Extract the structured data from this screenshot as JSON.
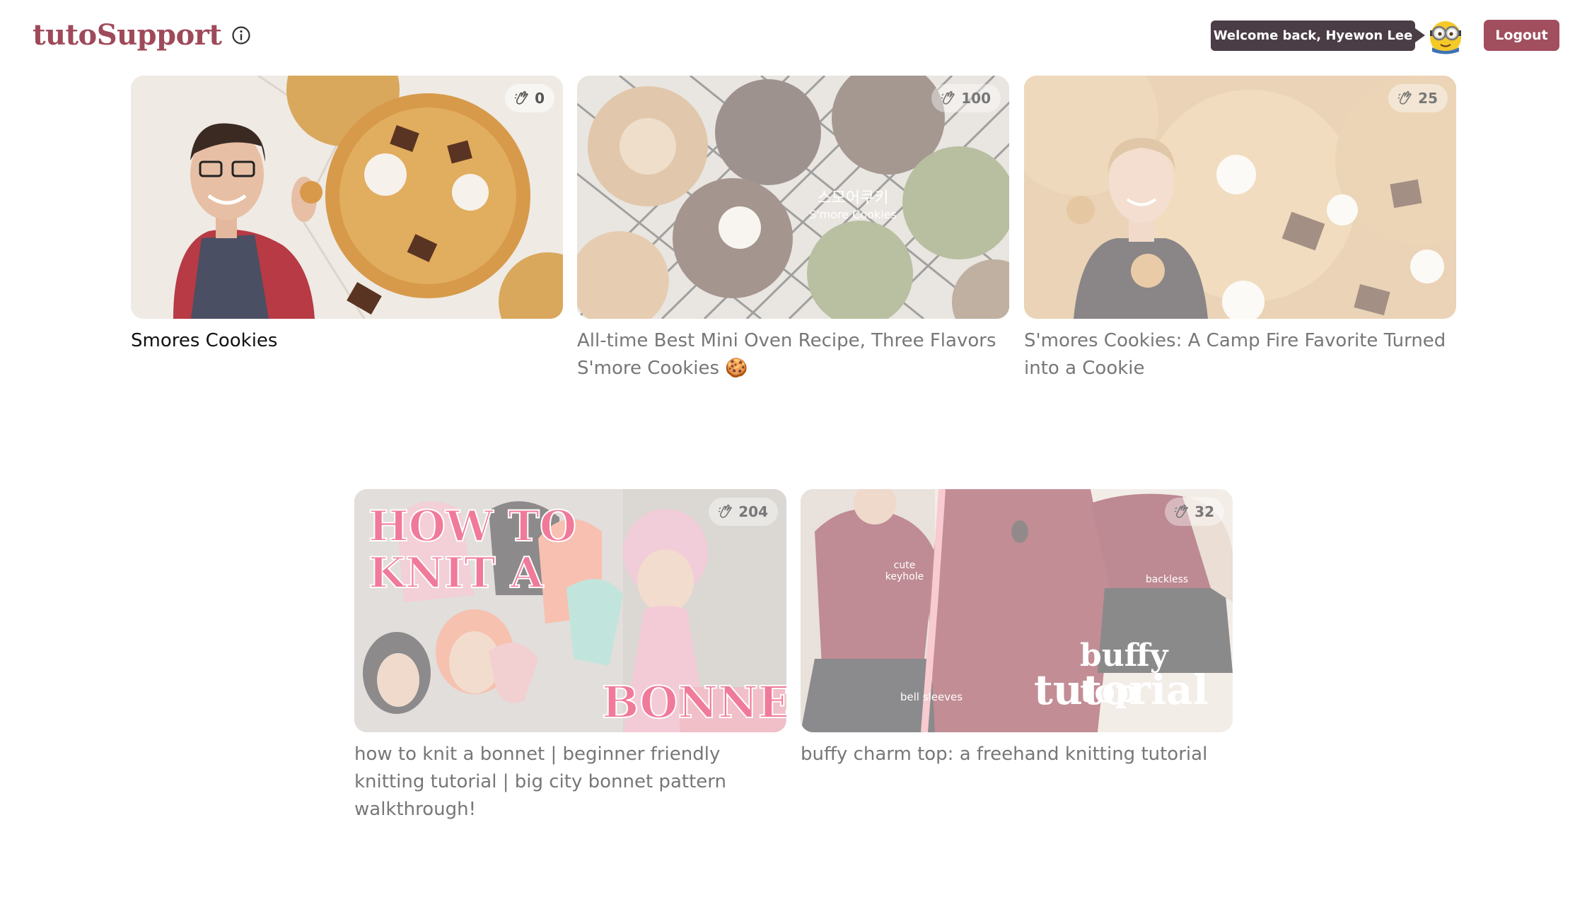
{
  "header": {
    "logo": "tutoSupport",
    "info_icon": "info-circle-icon",
    "welcome": "Welcome back, Hyewon Lee",
    "avatar_icon": "minion-avatar-icon",
    "logout_label": "Logout"
  },
  "colors": {
    "brand": "#9e4a5a",
    "logout_bg": "#a14e5e",
    "welcome_bg": "#4a3d45"
  },
  "badge_icon": "clapping-hands-icon",
  "videos": [
    {
      "title": "Smores Cookies",
      "claps": "0",
      "active": true,
      "thumb_icon": "cookie-thumbnail"
    },
    {
      "title": "All-time Best Mini Oven Recipe, Three Flavors S'more Cookies 🍪",
      "claps": "100",
      "active": false,
      "thumb_icon": "cookie-rack-thumbnail",
      "thumb_text_ko": "스모어쿠키",
      "thumb_text_en": "S'more Cookies"
    },
    {
      "title": "S'mores Cookies: A Camp Fire Favorite Turned into a Cookie",
      "claps": "25",
      "active": false,
      "thumb_icon": "cookie-woman-thumbnail"
    },
    {
      "title": "how to knit a bonnet | beginner friendly knitting tutorial | big city bonnet pattern walkthrough!",
      "claps": "204",
      "active": false,
      "thumb_icon": "bonnet-thumbnail",
      "thumb_text_top": "HOW TO KNIT A",
      "thumb_text_bottom": "BONNET!"
    },
    {
      "title": "buffy charm top: a freehand knitting tutorial",
      "claps": "32",
      "active": false,
      "thumb_icon": "sweater-thumbnail",
      "thumb_text_1": "buffy top",
      "thumb_text_2": "tutorial",
      "thumb_note_1": "cute keyhole",
      "thumb_note_2": "backless",
      "thumb_note_3": "bell sleeves"
    }
  ]
}
